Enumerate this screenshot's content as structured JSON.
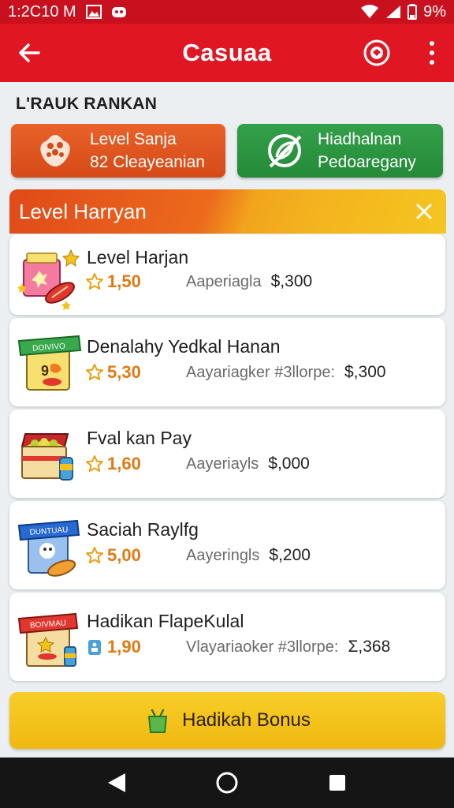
{
  "status_bar": {
    "time": "1:2C10 M",
    "battery": "9%"
  },
  "app_bar": {
    "title": "Casuaa"
  },
  "section_label": "L'RAUK RANKAN",
  "top_buttons": [
    {
      "line1": "Level Sanja",
      "line2": "82 Cleayeanian",
      "color": "#dc521c"
    },
    {
      "line1": "Hiadhalnan",
      "line2": "Pedoaregany",
      "color": "#2c963f"
    }
  ],
  "panel": {
    "title": "Level Harryan"
  },
  "cards": [
    {
      "title": "Level Harjan",
      "rating": "1,50",
      "desc": "Aaperiagla",
      "price": "$,300"
    },
    {
      "title": "Denalahy Yedkal Hanan",
      "rating": "5,30",
      "desc": "Aayariagker #3llorpe:",
      "price": "$,300",
      "icon_label": "DOIVIVO"
    },
    {
      "title": "Fval kan Pay",
      "rating": "1,60",
      "desc": "Aayeriayls",
      "price": "$,000"
    },
    {
      "title": "Saciah Raylfg",
      "rating": "5,00",
      "desc": "Aayeringls",
      "price": "$,200",
      "icon_label": "DUNTUAU"
    },
    {
      "title": "Hadikan FlapeKulal",
      "rating": "1,90",
      "desc": "Vlayariaoker #3llorpe:",
      "price": "Σ,368",
      "icon_label": "BOIVMAU"
    }
  ],
  "bonus_button": {
    "label": "Hadikah Bonus"
  },
  "colors": {
    "status_bar": "#c9101e",
    "app_bar": "#e01622",
    "rating": "#e07a10",
    "bonus": "#f4c21c"
  }
}
